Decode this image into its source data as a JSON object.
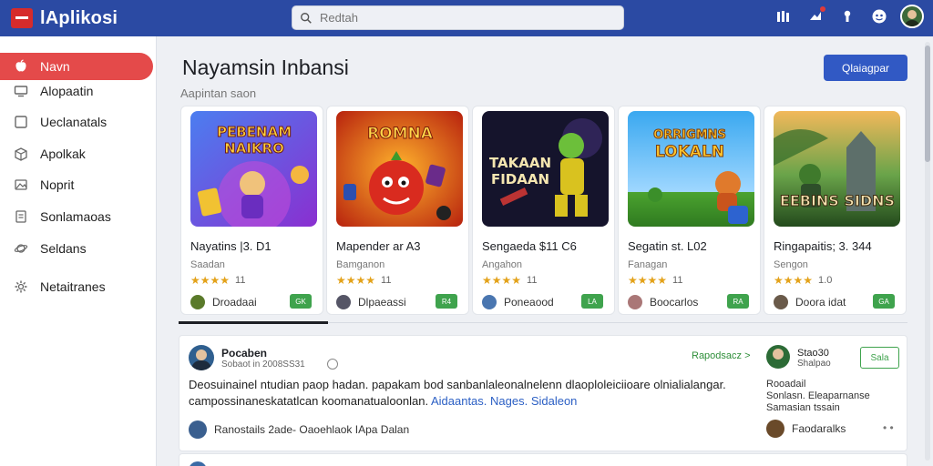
{
  "app": {
    "title": "lAplikosi",
    "search_placeholder": "Redtah"
  },
  "sidebar": {
    "items": [
      {
        "label": "Navn",
        "icon": "apple-icon",
        "active": true
      },
      {
        "label": "Alopaatin",
        "icon": "monitor-icon"
      },
      {
        "label": "Ueclanatals",
        "icon": "square-icon"
      },
      {
        "label": "Apolkak",
        "icon": "box-icon"
      },
      {
        "label": "Noprit",
        "icon": "image-icon"
      },
      {
        "label": "Sonlamaoas",
        "icon": "book-icon"
      },
      {
        "label": "Seldans",
        "icon": "planet-icon"
      },
      {
        "label": "Netaitranes",
        "icon": "gear-icon"
      }
    ]
  },
  "main": {
    "title": "Nayamsin Inbansi",
    "subtitle": "Aapintan saon",
    "primary_button": "Qlaiagpar"
  },
  "cards": [
    {
      "art_text": "PEBENAM NAIKRO",
      "title": "Nayatins |3. D1",
      "category": "Saadan",
      "stars": "★★★★",
      "rating": "11",
      "developer": "Droadaai",
      "action": "GK",
      "accent": "#7b3fd6"
    },
    {
      "art_text": "ROMNA",
      "title": "Mapender ar A3",
      "category": "Bamganon",
      "stars": "★★★★",
      "rating": "11",
      "developer": "Dlpaeassi",
      "action": "R4",
      "accent": "#e2551f"
    },
    {
      "art_text": "TAKAAN FIDAAN",
      "title": "Sengaeda $11 C6",
      "category": "Angahon",
      "stars": "★★★★",
      "rating": "11",
      "developer": "Poneaood",
      "action": "LA",
      "accent": "#1b1b3a"
    },
    {
      "art_text": "LOKALN",
      "title": "Segatin st. L02",
      "category": "Fanagan",
      "stars": "★★★★",
      "rating": "11",
      "developer": "Boocarlos",
      "action": "RA",
      "accent": "#2d8ee0"
    },
    {
      "art_text": "EEBINS SIDNS",
      "title": "Ringapaitis; 3. 344",
      "category": "Sengon",
      "stars": "★★★★",
      "rating": "1.0",
      "developer": "Doora idat",
      "action": "GA",
      "accent": "#3c7a38"
    }
  ],
  "review": {
    "name": "Pocaben",
    "meta": "Sobaot in 2008SS31",
    "link": "Rapodsacz >",
    "body_prefix": "Deosuinainel ntudian paop hadan. papakam bod sanbanlaleonalnelenn dlaoploleiciioare olnialialangar. campossinaneskatatlcan koomanatualoonlan.",
    "body_highlight": "Aidaantas. Nages. Sidaleon",
    "footer": "Ranostails 2ade- Oaoehlaok IApa Dalan",
    "side": {
      "title": "Stao30",
      "sub": "Shalpao",
      "button": "Sala",
      "lines": [
        "Rooadail",
        "Sonlasn. Eleaparnanse",
        "Samasian tssain"
      ],
      "footer": "Faodaralks",
      "more": "• •"
    }
  }
}
